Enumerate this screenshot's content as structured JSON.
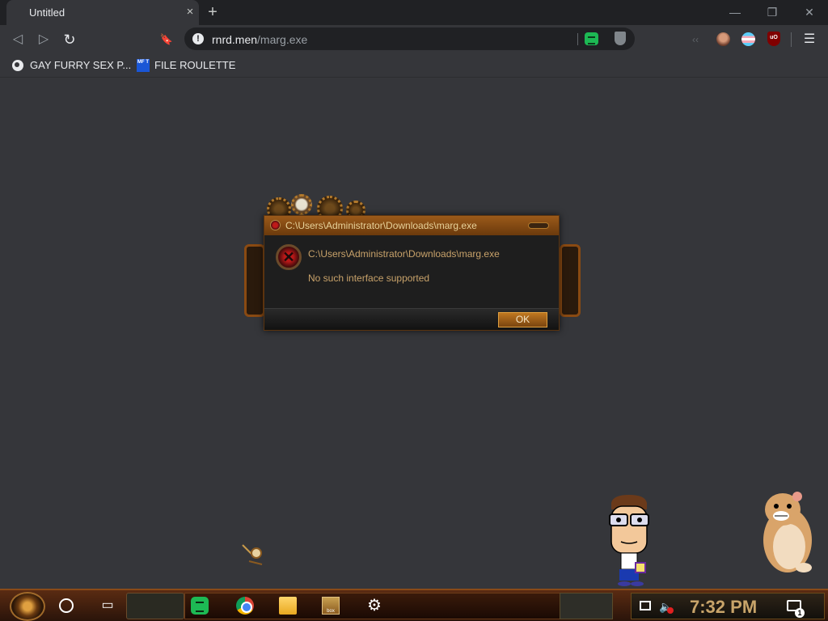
{
  "browser": {
    "tab_title": "Untitled",
    "tab_close_glyph": "×",
    "new_tab_glyph": "+",
    "window_controls": {
      "minimize": "—",
      "restore": "❐",
      "close": "✕"
    },
    "toolbar": {
      "back_glyph": "◁",
      "forward_glyph": "▷",
      "reload_glyph": "↻",
      "bookmark_glyph": "🔖",
      "url_host": "rnrd.men",
      "url_path": "/marg.exe",
      "menu_glyph": "☰",
      "ext_ublock_label": "uO"
    },
    "bookmarks": [
      {
        "label": "GAY FURRY SEX P...",
        "icon": "globe-icon"
      },
      {
        "label": "FILE ROULETTE",
        "icon": "file-roulette-icon",
        "icon_text": "MF T"
      }
    ]
  },
  "dialog": {
    "title": "C:\\Users\\Administrator\\Downloads\\marg.exe",
    "path": "C:\\Users\\Administrator\\Downloads\\marg.exe",
    "message": "No such interface supported",
    "ok_label": "OK",
    "error_glyph": "✕"
  },
  "taskbar": {
    "clock": "7:32 PM",
    "taskview_glyph": "▭",
    "settings_glyph": "⚙",
    "box_app_label": "box",
    "notification_count": "1",
    "volume_glyph": "🔈",
    "apps": [
      "spotify-icon",
      "chrome-icon",
      "file-explorer-icon",
      "box-app-icon",
      "settings-icon"
    ]
  },
  "colors": {
    "chrome_bg": "#35363a",
    "tabstrip_bg": "#202124",
    "dialog_accent": "#9b5a1a",
    "dialog_text": "#c8a26a",
    "clock_text": "#c8a46a"
  }
}
